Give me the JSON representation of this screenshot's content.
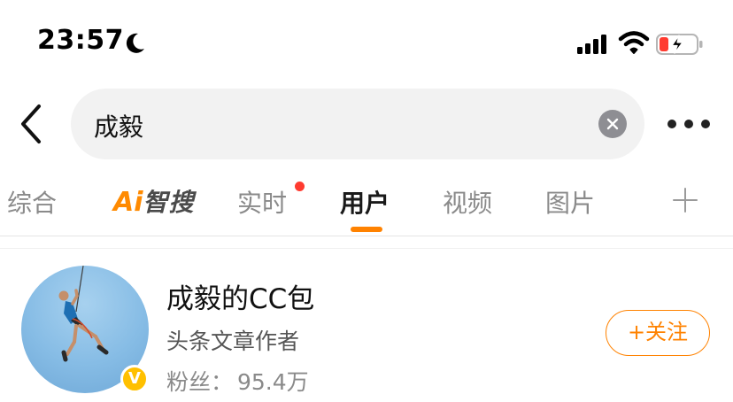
{
  "status_bar": {
    "time": "23:57",
    "battery_color": "#ff3b30"
  },
  "search": {
    "query": "成毅"
  },
  "tabs": [
    {
      "label": "综合"
    },
    {
      "label": "Ai",
      "suffix": "智搜"
    },
    {
      "label": "实时"
    },
    {
      "label": "用户"
    },
    {
      "label": "视频"
    },
    {
      "label": "图片"
    }
  ],
  "result": {
    "name": "成毅的CC包",
    "description": "头条文章作者",
    "fans_label": "粉丝：",
    "fans_count": "95.4万",
    "verified_badge": "V",
    "follow_label": "+关注"
  },
  "colors": {
    "accent": "#ff8200",
    "verified": "#ffc000"
  }
}
